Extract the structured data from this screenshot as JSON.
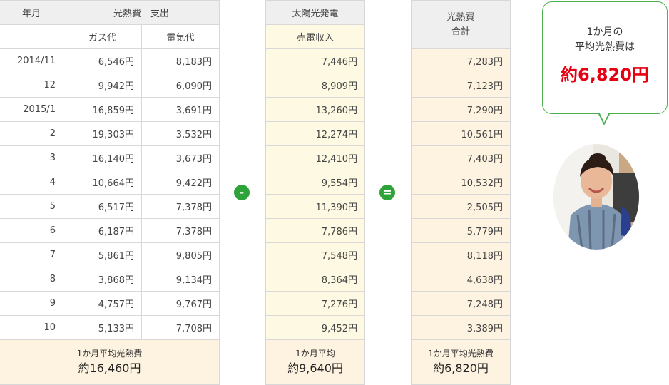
{
  "table1": {
    "h_month": "年月",
    "h_expense": "光熱費　支出",
    "h_gas": "ガス代",
    "h_elec": "電気代",
    "rows": [
      {
        "month": "2014/11",
        "gas": "6,546円",
        "elec": "8,183円"
      },
      {
        "month": "12",
        "gas": "9,942円",
        "elec": "6,090円"
      },
      {
        "month": "2015/1",
        "gas": "16,859円",
        "elec": "3,691円"
      },
      {
        "month": "2",
        "gas": "19,303円",
        "elec": "3,532円"
      },
      {
        "month": "3",
        "gas": "16,140円",
        "elec": "3,673円"
      },
      {
        "month": "4",
        "gas": "10,664円",
        "elec": "9,422円"
      },
      {
        "month": "5",
        "gas": "6,517円",
        "elec": "7,378円"
      },
      {
        "month": "6",
        "gas": "6,187円",
        "elec": "7,378円"
      },
      {
        "month": "7",
        "gas": "5,861円",
        "elec": "9,805円"
      },
      {
        "month": "8",
        "gas": "3,868円",
        "elec": "9,134円"
      },
      {
        "month": "9",
        "gas": "4,757円",
        "elec": "9,767円"
      },
      {
        "month": "10",
        "gas": "5,133円",
        "elec": "7,708円"
      }
    ],
    "foot_label": "1か月平均光熱費",
    "foot_value": "約16,460円"
  },
  "minus_symbol": "-",
  "table2": {
    "h_solar": "太陽光発電",
    "h_sales": "売電収入",
    "rows": [
      "7,446円",
      "8,909円",
      "13,260円",
      "12,274円",
      "12,410円",
      "9,554円",
      "11,390円",
      "7,786円",
      "7,548円",
      "8,364円",
      "7,276円",
      "9,452円"
    ],
    "foot_label": "1か月平均",
    "foot_value": "約9,640円"
  },
  "equals_symbol": "=",
  "table3": {
    "h_line1": "光熱費",
    "h_line2": "合計",
    "rows": [
      "7,283円",
      "7,123円",
      "7,290円",
      "10,561円",
      "7,403円",
      "10,532円",
      "2,505円",
      "5,779円",
      "8,118円",
      "4,638円",
      "7,248円",
      "3,389円"
    ],
    "foot_label": "1か月平均光熱費",
    "foot_value": "約6,820円"
  },
  "bubble": {
    "line1": "1か月の",
    "line2": "平均光熱費は",
    "amount": "約6,820円"
  },
  "colors": {
    "accent_green": "#2ea33a",
    "amount_red": "#e60012",
    "header_grey": "#efefef",
    "cream": "#fdf3e0",
    "yellow": "#fdf9e2"
  }
}
